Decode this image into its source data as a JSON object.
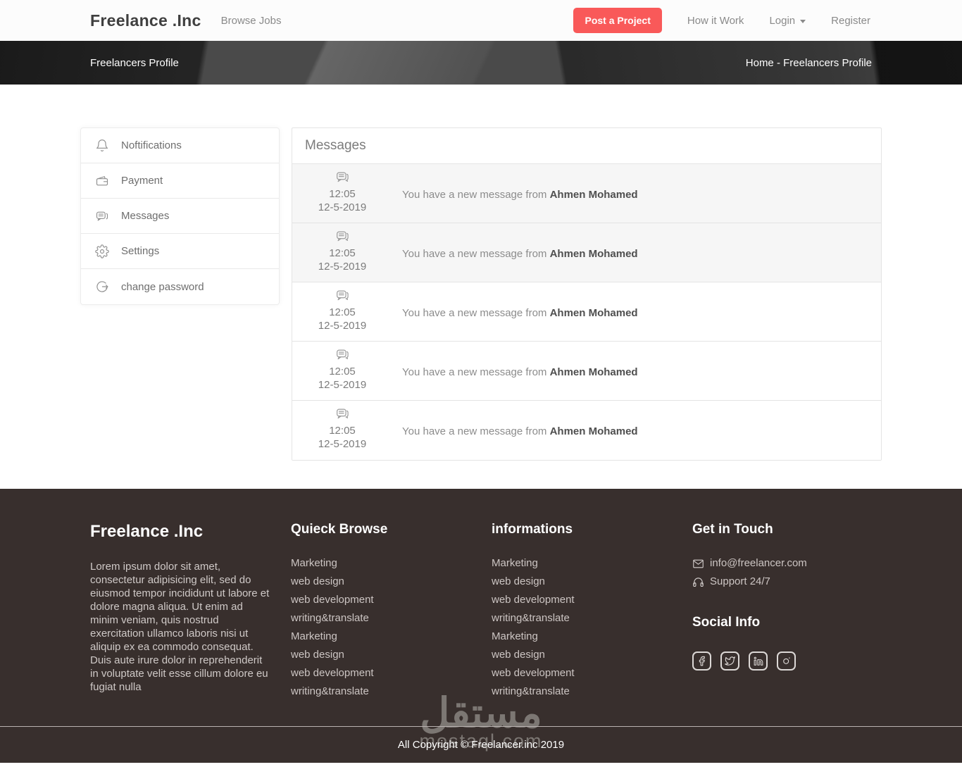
{
  "colors": {
    "accent": "#f95959",
    "footer_bg": "#382f2d",
    "row_highlight": "#f6f6f6"
  },
  "nav": {
    "brand": "Freelance .Inc",
    "browse_jobs": "Browse Jobs",
    "post_project": "Post a Project",
    "how_it_work": "How it Work",
    "login": "Login",
    "register": "Register"
  },
  "breadcrumb": {
    "title": "Freelancers Profile",
    "path": "Home - Freelancers Profile"
  },
  "sidebar": {
    "items": [
      {
        "label": "Noftifications",
        "icon": "bell-icon"
      },
      {
        "label": "Payment",
        "icon": "wallet-icon"
      },
      {
        "label": "Messages",
        "icon": "chat-icon"
      },
      {
        "label": "Settings",
        "icon": "gear-icon"
      },
      {
        "label": "change password",
        "icon": "logout-arrow-icon"
      }
    ]
  },
  "messages": {
    "title": "Messages",
    "rows": [
      {
        "icon": "chat-bubble-icon",
        "time": "12:05",
        "date": "12-5-2019",
        "text": "You have a new message from",
        "sender": "Ahmen Mohamed",
        "variant": "gray"
      },
      {
        "icon": "chat-bubble-icon",
        "time": "12:05",
        "date": "12-5-2019",
        "text": "You have a new message from",
        "sender": "Ahmen Mohamed",
        "variant": "gray"
      },
      {
        "icon": "chat-bubble-icon",
        "time": "12:05",
        "date": "12-5-2019",
        "text": "You have a new message from",
        "sender": "Ahmen Mohamed",
        "variant": "white"
      },
      {
        "icon": "chat-bubble-icon",
        "time": "12:05",
        "date": "12-5-2019",
        "text": "You have a new message from",
        "sender": "Ahmen Mohamed",
        "variant": "white"
      },
      {
        "icon": "chat-bubble-icon",
        "time": "12:05",
        "date": "12-5-2019",
        "text": "You have a new message from",
        "sender": "Ahmen Mohamed",
        "variant": "white"
      }
    ]
  },
  "footer": {
    "about": {
      "title": "Freelance .Inc",
      "text": "Lorem ipsum dolor sit amet, consectetur adipisicing elit, sed do eiusmod tempor incididunt ut labore et dolore magna aliqua. Ut enim ad minim veniam, quis nostrud exercitation ullamco laboris nisi ut aliquip ex ea commodo consequat. Duis aute irure dolor in reprehenderit in voluptate velit esse cillum dolore eu fugiat nulla"
    },
    "quick_browse": {
      "title": "Quieck Browse",
      "links": [
        "Marketing",
        "web design",
        "web development",
        "writing&translate",
        "Marketing",
        "web design",
        "web development",
        "writing&translate"
      ]
    },
    "informations": {
      "title": "informations",
      "links": [
        "Marketing",
        "web design",
        "web development",
        "writing&translate",
        "Marketing",
        "web design",
        "web development",
        "writing&translate"
      ]
    },
    "get_in_touch": {
      "title": "Get in Touch",
      "email": "info@freelancer.com",
      "support": "Support 24/7"
    },
    "social": {
      "title": "Social Info",
      "icons": [
        "facebook",
        "twitter",
        "linkedin",
        "instagram"
      ]
    },
    "copyright": "All Copyright © Freelancer.inc 2019",
    "watermark": {
      "arabic": "مستقل",
      "latin": "mostaql.com"
    }
  }
}
